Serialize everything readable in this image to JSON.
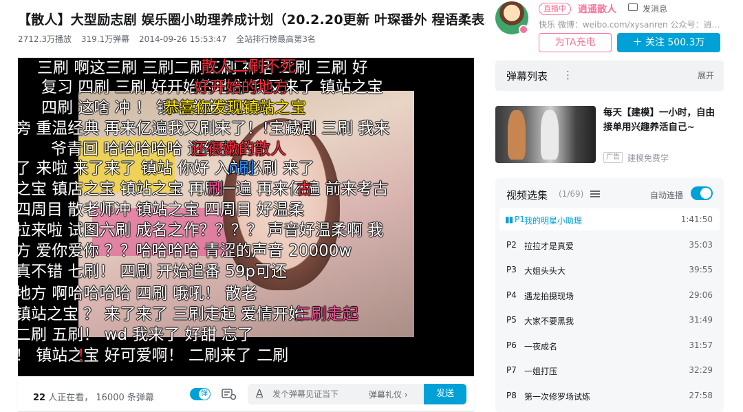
{
  "video": {
    "title": "【散人】大型励志剧 娱乐圈小助理养成计划（20.2.20更新 叶琛番外 程语柔表…",
    "plays": "2712.3万播放",
    "danmaku_count": "319.1万弹幕",
    "date": "2014-09-26 15:53:47",
    "rank": "全站排行榜最高第3名"
  },
  "danmaku": [
    {
      "text": "三刷  啊这三刷     三刷二刷三刷  神话 二刷 三刷  好",
      "color": "white"
    },
    {
      "text": "散人二刷不死",
      "color": "red"
    },
    {
      "text": "复习 四刷 三刷     好开始的地方      我又来了  镇站之宝",
      "color": "white"
    },
    {
      "text": "好开始的地方",
      "color": "red"
    },
    {
      "text": "四刷     这啥 冲                        ！ 镇站之宝  我又来",
      "color": "white"
    },
    {
      "text": "恭喜你发现镇站之宝",
      "color": "yellow"
    },
    {
      "text": "旁 重温经典   再来亿遍我又刷来了！!宝藏剧    三刷     我来",
      "color": "white"
    },
    {
      "text": "爷青回                                哈哈哈哈哈      连续剧  三",
      "color": "white"
    },
    {
      "text": "还很嫩的散人",
      "color": "red"
    },
    {
      "text": "了 来啦 来了来了      镇站              你好     入站必刷    来了",
      "color": "white"
    },
    {
      "text": "n刷",
      "color": "blue"
    },
    {
      "text": "之宝  镇店之宝  镇站之宝  再刷一遍   再来亿遍  前来考古",
      "color": "white"
    },
    {
      "text": "刷",
      "color": "pink"
    },
    {
      "text": "古",
      "color": "red"
    },
    {
      "text": "  四周目      散老师冲    镇站之宝      四周目        好温柔",
      "color": "white"
    },
    {
      "text": "拉来啦  试图六刷  成名之作？？？？     声音好温柔啊    我",
      "color": "white"
    },
    {
      "text": "方      爱你爱你    ？？哈哈哈哈    青涩的声音     20000w",
      "color": "white"
    },
    {
      "text": "     真不错  七刷！         四刷        开始追番         59p可还",
      "color": "white"
    },
    {
      "text": "地方      啊哈哈哈哈            四刷              哦吼！            散老",
      "color": "white"
    },
    {
      "text": "镇站之宝            ？      来了来了      三刷走起         爱情开始",
      "color": "white"
    },
    {
      "text": "三刷走起",
      "color": "pink"
    },
    {
      "text": "二刷      五刷！       wd     我来了           好甜               忘了",
      "color": "white"
    },
    {
      "text": "                 ！     镇站之宝     好可爱啊！        二刷来了        二刷",
      "color": "white"
    },
    {
      "text": "！",
      "color": "red"
    }
  ],
  "danmaku_bar": {
    "viewers_count": "22",
    "viewers_suffix": "人正在看，",
    "dm_total": "16000 条弹幕",
    "toggle_label": "弹",
    "input_icon": "A",
    "input_placeholder": "发个弹幕见证当下",
    "etiquette": "弹幕礼仪 ›",
    "send": "发送"
  },
  "uploader": {
    "live_badge": "直播中",
    "name": "逍遥散人",
    "message": "发消息",
    "description": "快乐 微博：weibo.com/xysanren 公众号：逍…",
    "charge": "为TA充电",
    "follow": "＋  关注 500.3万"
  },
  "danmaku_list": {
    "title": "弹幕列表",
    "more": "⋮",
    "expand": "展开"
  },
  "ad": {
    "title": "每天【建模】一小时，自由接单用兴趣养活自己~",
    "tag": "广告",
    "source": "建模免费学"
  },
  "episodes": {
    "title": "视频选集",
    "count": "(1/69)",
    "autoplay": "自动连播",
    "items": [
      {
        "num": "P1",
        "name": "我的明星小助理",
        "dur": "1:41:50"
      },
      {
        "num": "P2",
        "name": "拉拉才是真爱",
        "dur": "35:03"
      },
      {
        "num": "P3",
        "name": "大姐头头大",
        "dur": "39:55"
      },
      {
        "num": "P4",
        "name": "遇龙拍摄现场",
        "dur": "29:06"
      },
      {
        "num": "P5",
        "name": "大家不要黑我",
        "dur": "31:49"
      },
      {
        "num": "P6",
        "name": "一夜成名",
        "dur": "31:57"
      },
      {
        "num": "P7",
        "name": "一姐打压",
        "dur": "32:29"
      },
      {
        "num": "P8",
        "name": "第一次修罗场试炼",
        "dur": "27:58"
      }
    ]
  },
  "colors": {
    "accent": "#00a1d6",
    "pink": "#fb7299"
  }
}
